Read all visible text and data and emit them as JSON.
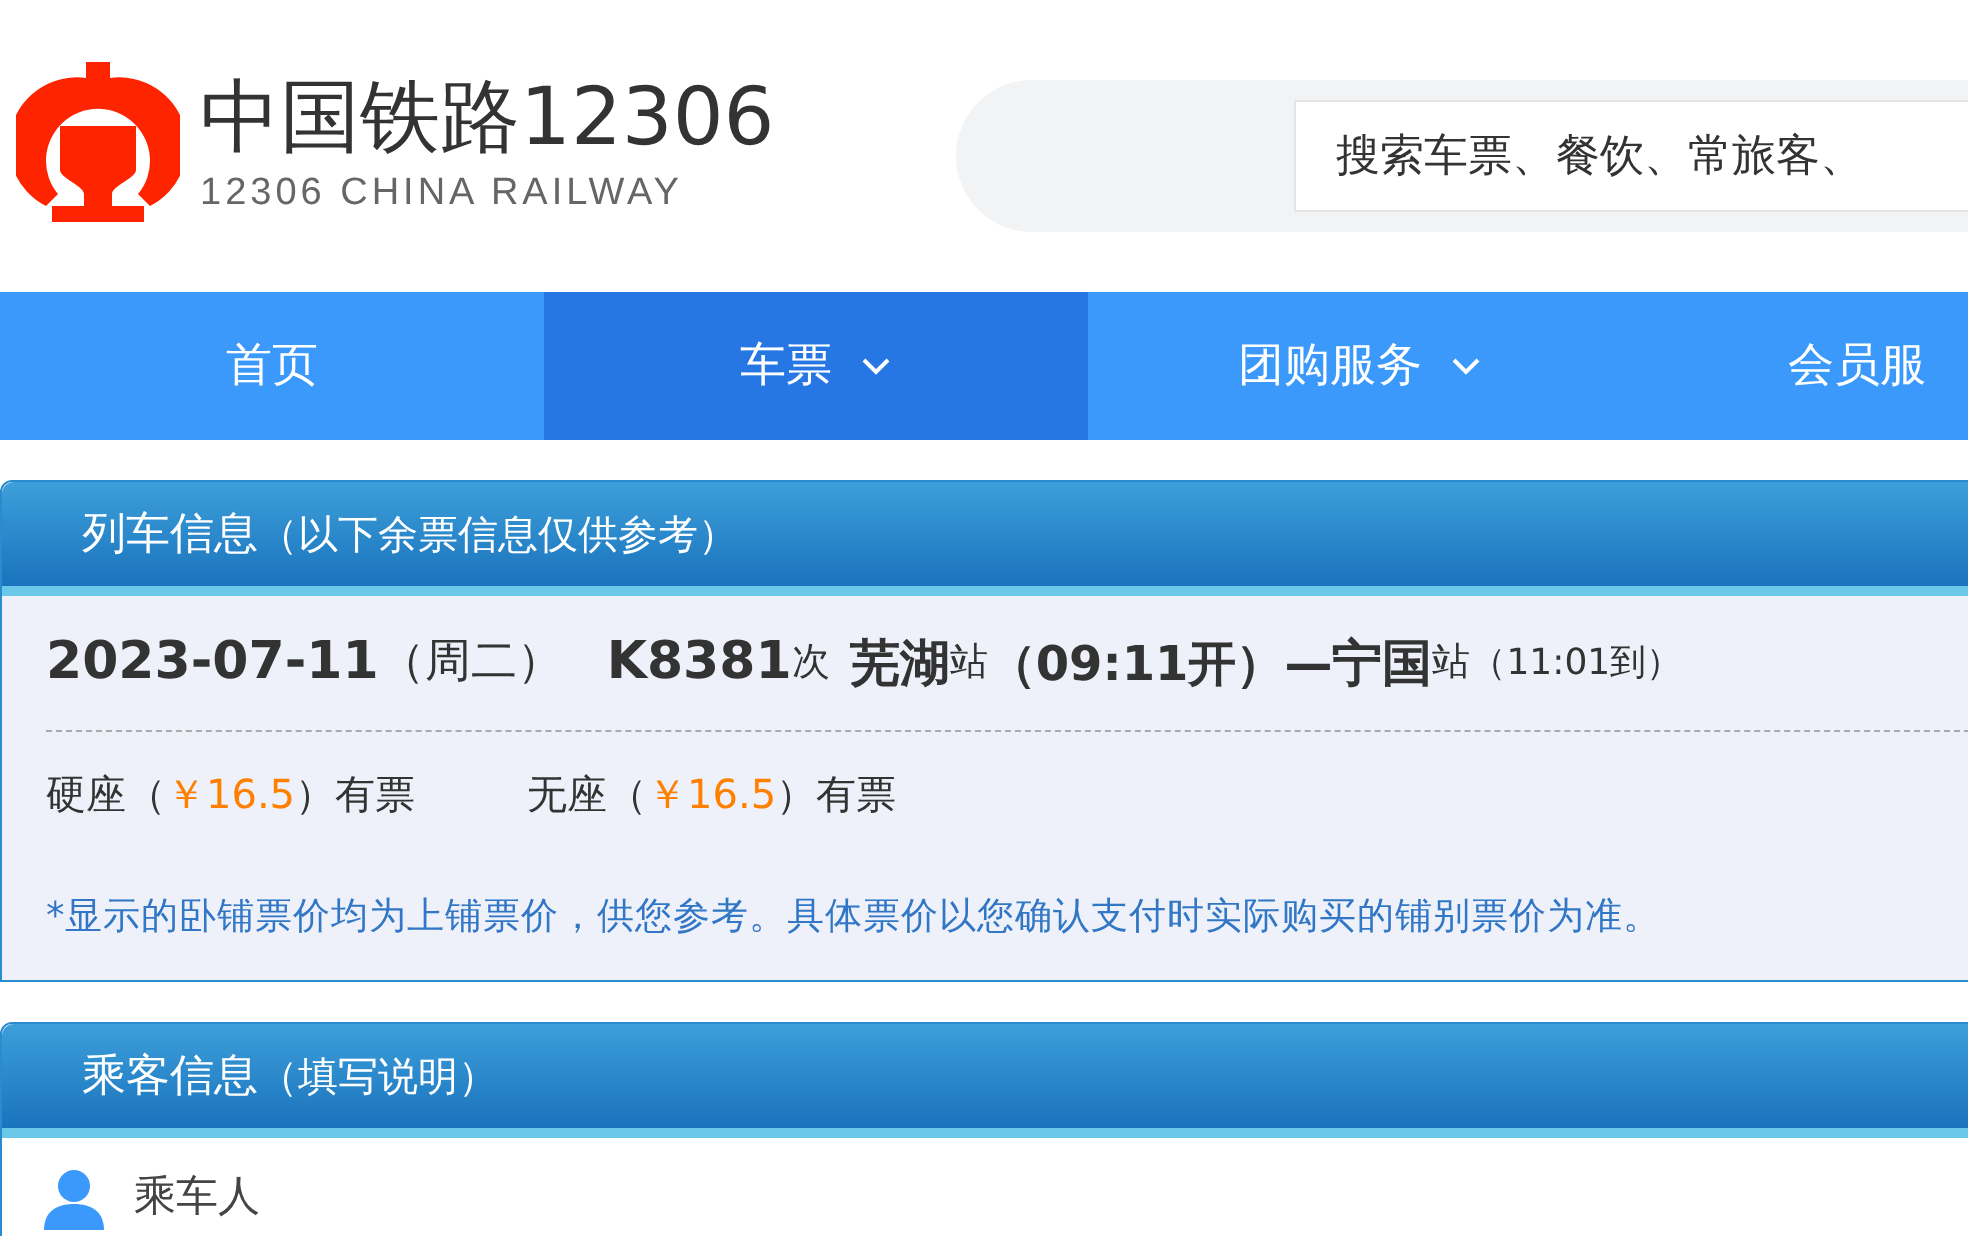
{
  "header": {
    "logo_title": "中国铁路12306",
    "logo_subtitle": "12306 CHINA RAILWAY",
    "search": {
      "placeholder": "搜索车票、餐饮、常旅客、"
    }
  },
  "nav": [
    {
      "label": "首页",
      "selected": false,
      "has_menu": false
    },
    {
      "label": "车票",
      "selected": true,
      "has_menu": true
    },
    {
      "label": "团购服务",
      "selected": false,
      "has_menu": true
    },
    {
      "label": "会员服",
      "selected": false,
      "has_menu": false
    }
  ],
  "train_panel": {
    "title": "列车信息",
    "title_note": "（以下余票信息仅供参考）",
    "date": "2023-07-11",
    "weekday": "（周二）",
    "train_no": "K8381",
    "train_suffix": "次",
    "from_station": "芜湖",
    "from_suffix": "站",
    "departure": "（09:11开）",
    "dash": "—",
    "to_station": "宁国",
    "to_suffix": "站",
    "arrival": "（11:01到）",
    "seats": [
      {
        "name": "硬座",
        "open": "（",
        "price": "￥16.5",
        "close": "）",
        "status": "有票"
      },
      {
        "name": "无座",
        "open": "（",
        "price": "￥16.5",
        "close": "）",
        "status": "有票"
      }
    ],
    "notice": "*显示的卧铺票价均为上铺票价，供您参考。具体票价以您确认支付时实际购买的铺别票价为准。"
  },
  "passenger_panel": {
    "title": "乘客信息",
    "title_note": "（填写说明）",
    "passenger_label": "乘车人"
  }
}
